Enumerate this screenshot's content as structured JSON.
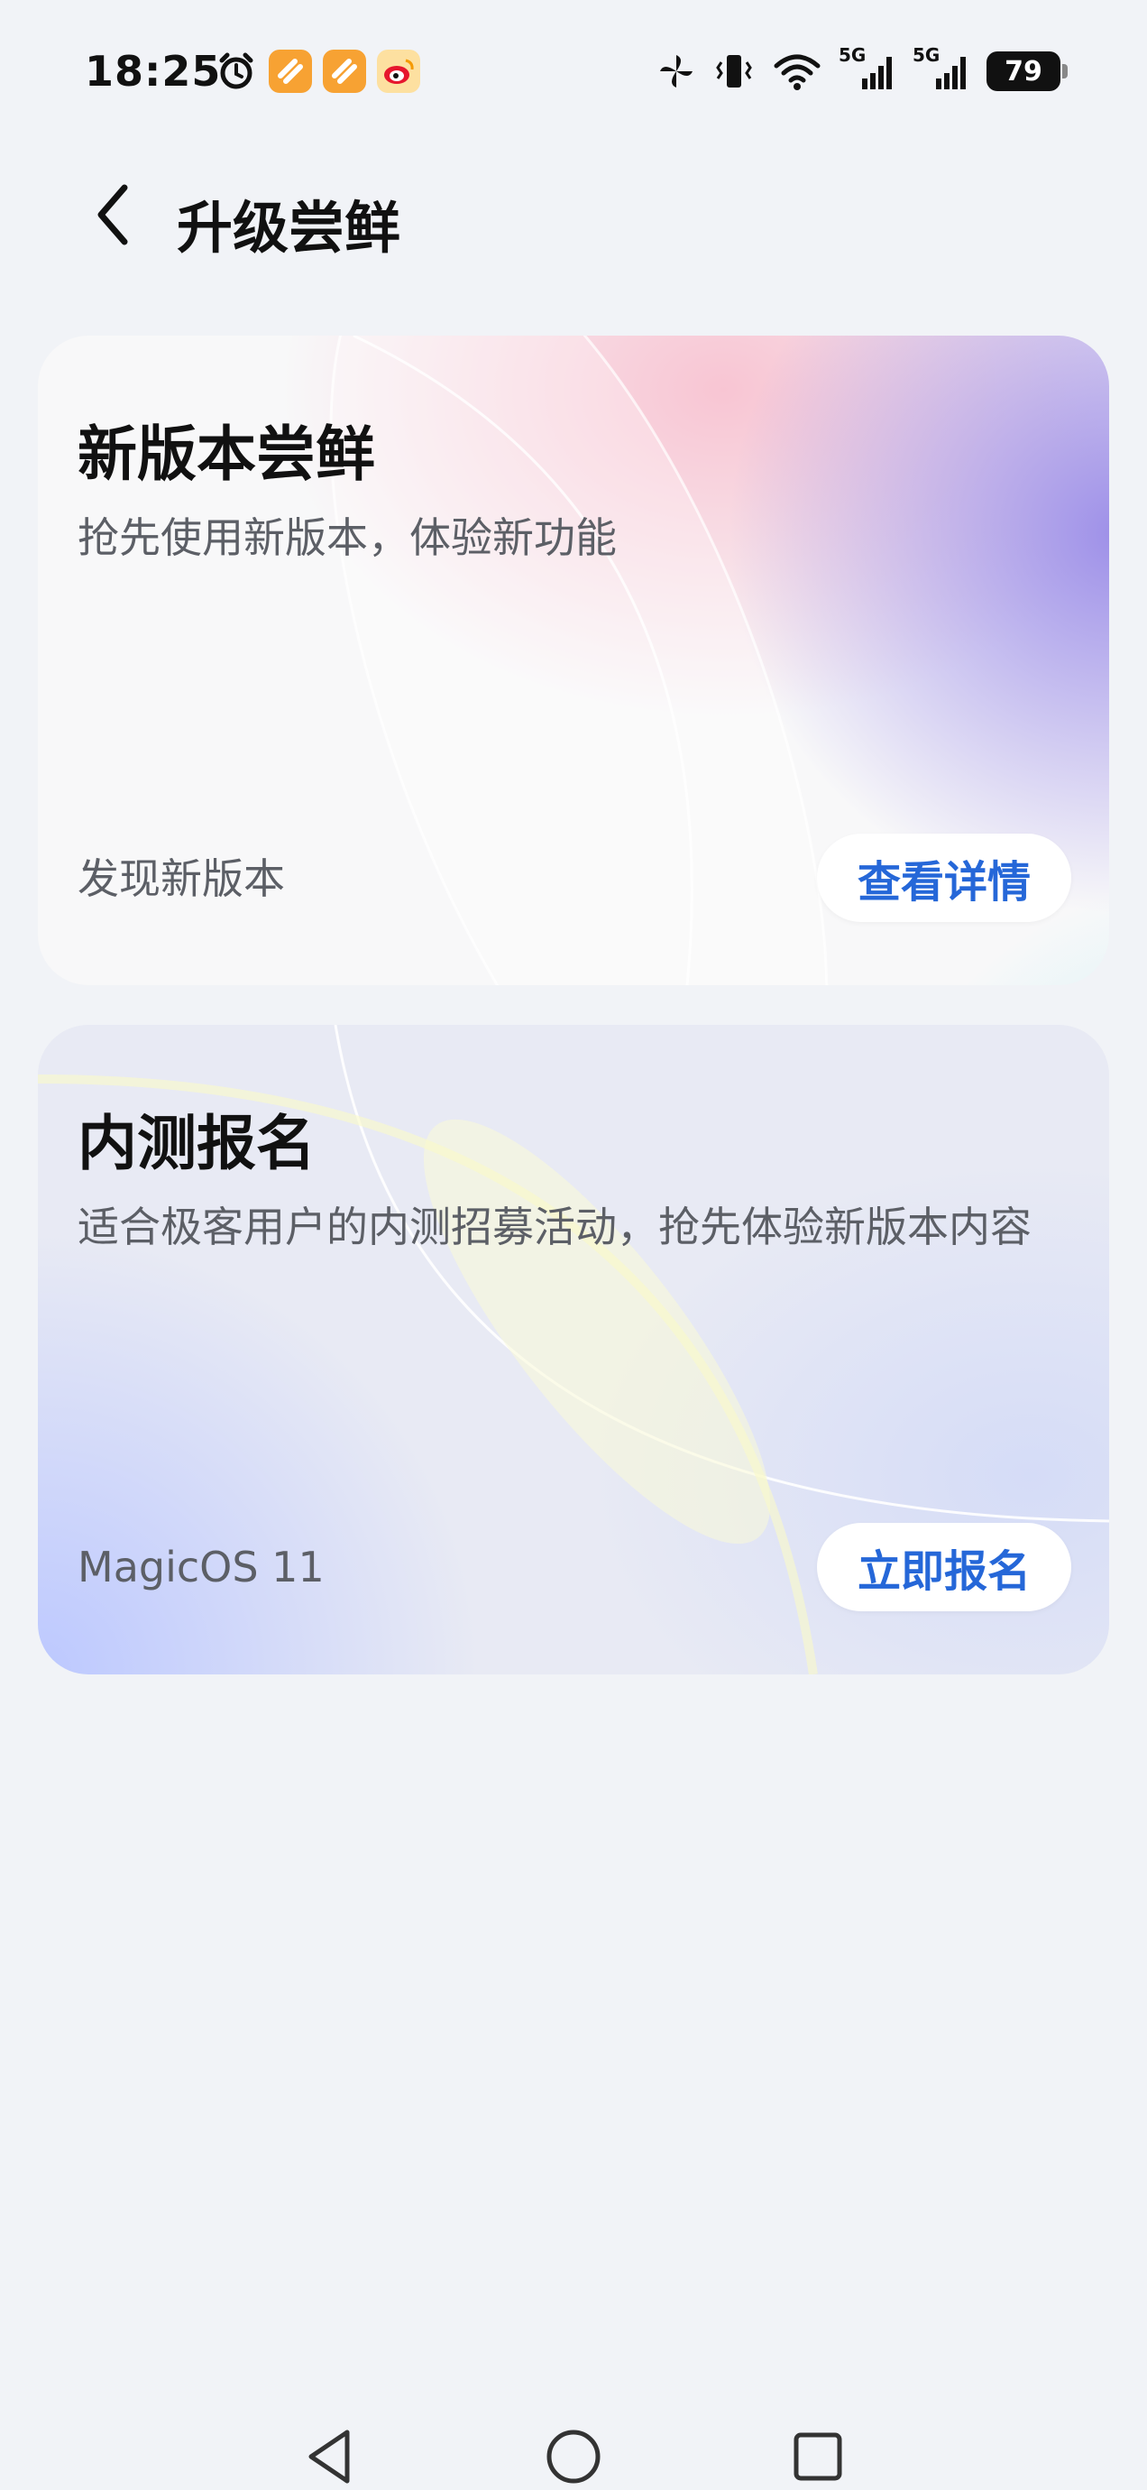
{
  "status_bar": {
    "time": "18:25",
    "left_icons": [
      "alarm-icon",
      "app-notification-icon",
      "app-notification-icon",
      "weibo-icon"
    ],
    "right_icons": [
      "pinwheel-icon",
      "vibrate-icon",
      "wifi-icon",
      "signal-5g-icon",
      "signal-5g-icon"
    ],
    "network_label_1": "5G",
    "network_label_2": "5G",
    "battery_level": "79"
  },
  "header": {
    "title": "升级尝鲜"
  },
  "cards": [
    {
      "title": "新版本尝鲜",
      "subtitle": "抢先使用新版本，体验新功能",
      "footer_text": "发现新版本",
      "button_label": "查看详情"
    },
    {
      "title": "内测报名",
      "subtitle": "适合极客用户的内测招募活动，抢先体验新版本内容",
      "footer_text": "MagicOS 11",
      "button_label": "立即报名"
    }
  ],
  "colors": {
    "background": "#f1f3f7",
    "accent": "#2567d8",
    "title_text": "#111111",
    "secondary_text": "#5c5f66"
  },
  "nav_bar": {
    "icons": [
      "back-triangle-icon",
      "home-circle-icon",
      "recents-square-icon"
    ]
  }
}
